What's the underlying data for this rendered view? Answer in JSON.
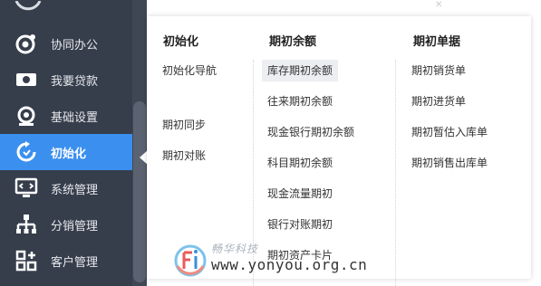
{
  "sidebar": {
    "items": [
      {
        "label": "协同办公",
        "icon": "collaboration-icon",
        "active": false
      },
      {
        "label": "我要贷款",
        "icon": "loan-icon",
        "active": false
      },
      {
        "label": "基础设置",
        "icon": "settings-icon",
        "active": false
      },
      {
        "label": "初始化",
        "icon": "initialize-icon",
        "active": true
      },
      {
        "label": "系统管理",
        "icon": "system-admin-icon",
        "active": false
      },
      {
        "label": "分销管理",
        "icon": "distribution-icon",
        "active": false
      },
      {
        "label": "客户管理",
        "icon": "customer-icon",
        "active": false
      }
    ]
  },
  "menu": {
    "columns": [
      {
        "title": "初始化",
        "items": [
          "初始化导航",
          "期初同步",
          "期初对账"
        ]
      },
      {
        "title": "期初余额",
        "items": [
          "库存期初余额",
          "往来期初余额",
          "现金银行期初余额",
          "科目期初余额",
          "现金流量期初",
          "银行对账期初",
          "期初资产卡片"
        ]
      },
      {
        "title": "期初单据",
        "items": [
          "期初销货单",
          "期初进货单",
          "期初暂估入库单",
          "期初销售出库单"
        ]
      }
    ],
    "highlighted_item": "库存期初余额"
  },
  "watermark": {
    "logo_icon": "yonyou-fi-logo",
    "name": "畅华科技",
    "url": "www.yonyou.org.cn"
  },
  "colors": {
    "sidebar_bg": "#363e4c",
    "active_bg": "#3b8fef",
    "highlight_bg": "#eceef1"
  }
}
